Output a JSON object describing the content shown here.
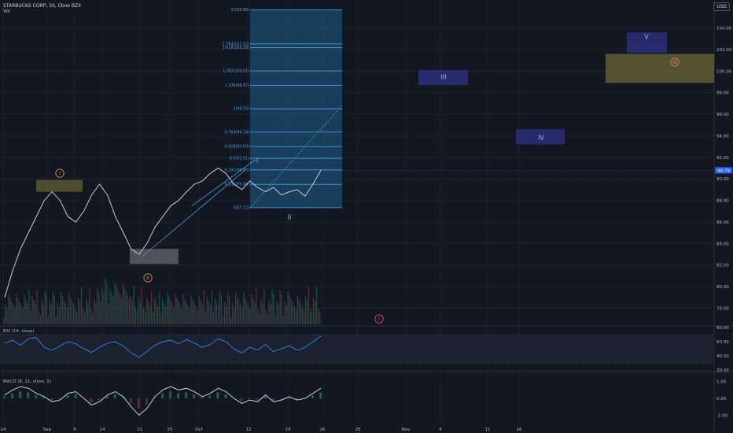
{
  "header": {
    "symbol_line": "STARBUCKS CORP, 30, Cboe BZX",
    "volume_label": "Vol",
    "currency": "USD"
  },
  "chart_data": [
    {
      "type": "line",
      "panel": "price",
      "y_ticks": [
        "104.00",
        "102.00",
        "100.00",
        "98.00",
        "96.00",
        "94.00",
        "92.00",
        "90.00",
        "88.00",
        "86.00",
        "84.00",
        "82.00",
        "80.00",
        "78.00"
      ],
      "ylim": [
        76.5,
        105.5
      ],
      "last_price": "90.79",
      "x_ticks": [
        "24",
        "Sep",
        "8",
        "14",
        "21",
        "25",
        "Oct",
        "12",
        "19",
        "26",
        "28",
        "Nov",
        "4",
        "11",
        "16"
      ],
      "series": [
        {
          "values": [
            79.0,
            81.5,
            83.5,
            85.0,
            86.5,
            88.0,
            88.8,
            88.0,
            86.5,
            86.0,
            87.0,
            88.5,
            89.5,
            88.5,
            86.5,
            85.0,
            83.5,
            83.0,
            84.0,
            85.5,
            86.5,
            87.5,
            88.0,
            88.8,
            89.5,
            89.8,
            90.5,
            91.0,
            90.5,
            89.5,
            89.0,
            89.8,
            89.2,
            88.8,
            89.2,
            88.5,
            88.8,
            89.0,
            88.4,
            89.5,
            90.8
          ]
        }
      ],
      "fib_levels": [
        {
          "label": "2(105.68)",
          "value": 105.68
        },
        {
          "label": "1.764(102.52)",
          "value": 102.52
        },
        {
          "label": "1.618(102.18)",
          "value": 102.18
        },
        {
          "label": "1.382(100.01)",
          "value": 100.01
        },
        {
          "label": "1.236(98.67)",
          "value": 98.67
        },
        {
          "label": "1(96.50)",
          "value": 96.5
        },
        {
          "label": "0.764(94.34)",
          "value": 94.34
        },
        {
          "label": "0.618(93.00)",
          "value": 93.0
        },
        {
          "label": "0.5(91.91)",
          "value": 91.91
        },
        {
          "label": "0.382(90.83)",
          "value": 90.83
        },
        {
          "label": "0.236(89.49)",
          "value": 89.49
        },
        {
          "label": "0(87.32)",
          "value": 87.32
        }
      ],
      "wave_labels": [
        {
          "text": "I",
          "style": "circle",
          "color": "#d98a57"
        },
        {
          "text": "II",
          "style": "circle",
          "color": "#d98a57"
        },
        {
          "text": "III",
          "style": "circle",
          "color": "#d98a57"
        },
        {
          "text": "I",
          "style": "plain",
          "color": "#b2b5be"
        },
        {
          "text": "II",
          "style": "plain",
          "color": "#b2b5be"
        },
        {
          "text": "III",
          "style": "plain",
          "color": "#b2b5be"
        },
        {
          "text": "IV",
          "style": "plain",
          "color": "#b2b5be"
        },
        {
          "text": "V",
          "style": "plain",
          "color": "#b2b5be"
        },
        {
          "text": "I",
          "style": "circle",
          "color": "#e04f4f"
        }
      ]
    },
    {
      "type": "line",
      "panel": "rsi",
      "title": "RSI (14, close)",
      "y_ticks": [
        "80.00",
        "60.00",
        "40.00",
        "20.00"
      ],
      "ylim": [
        20,
        80
      ],
      "bands": [
        70,
        30
      ],
      "series": [
        {
          "values": [
            58,
            62,
            55,
            64,
            66,
            52,
            48,
            54,
            60,
            57,
            50,
            45,
            52,
            58,
            60,
            54,
            44,
            38,
            46,
            55,
            60,
            62,
            57,
            63,
            58,
            52,
            56,
            64,
            60,
            50,
            44,
            52,
            48,
            56,
            46,
            50,
            54,
            48,
            52,
            60,
            68
          ]
        }
      ]
    },
    {
      "type": "line",
      "panel": "macd",
      "title": "MACD (8, 21, close, 5)",
      "y_ticks": [
        "1.00",
        "0.00",
        "-1.00"
      ],
      "ylim": [
        -1.5,
        1.5
      ],
      "series": [
        {
          "values": [
            0.2,
            0.5,
            0.7,
            0.6,
            0.3,
            0.1,
            -0.2,
            -0.1,
            0.3,
            0.4,
            0.0,
            -0.4,
            -0.2,
            0.2,
            0.4,
            0.1,
            -0.5,
            -1.0,
            -0.6,
            0.1,
            0.5,
            0.7,
            0.5,
            0.6,
            0.4,
            0.1,
            0.3,
            0.6,
            0.4,
            0.0,
            -0.3,
            -0.1,
            -0.2,
            0.2,
            -0.2,
            -0.1,
            0.1,
            -0.1,
            0.0,
            0.3,
            0.6
          ]
        }
      ]
    }
  ]
}
